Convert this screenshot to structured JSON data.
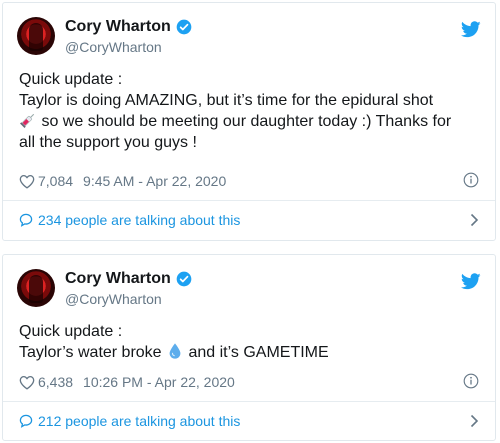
{
  "tweets": [
    {
      "name": "Cory Wharton",
      "handle": "@CoryWharton",
      "text_l1": "Quick update :",
      "text_l2": "Taylor is doing AMAZING, but it’s time for the epidural shot",
      "text_l3": "so we should be meeting our daughter today :) Thanks for",
      "text_l4": "all the support you guys !",
      "likes": "7,084",
      "time": "9:45 AM - Apr 22, 2020",
      "talking": "234 people are talking about this",
      "emoji": "syringe-icon"
    },
    {
      "name": "Cory Wharton",
      "handle": "@CoryWharton",
      "text_l1": "Quick update :",
      "text_l2a": "Taylor’s water broke",
      "text_l2b": "and it’s GAMETIME",
      "likes": "6,438",
      "time": "10:26 PM - Apr 22, 2020",
      "talking": "212 people are talking about this",
      "emoji": "droplet-icon"
    }
  ],
  "colors": {
    "link": "#1b95e0",
    "muted": "#657786",
    "verified": "#1da1f2",
    "twitter": "#1da1f2"
  }
}
